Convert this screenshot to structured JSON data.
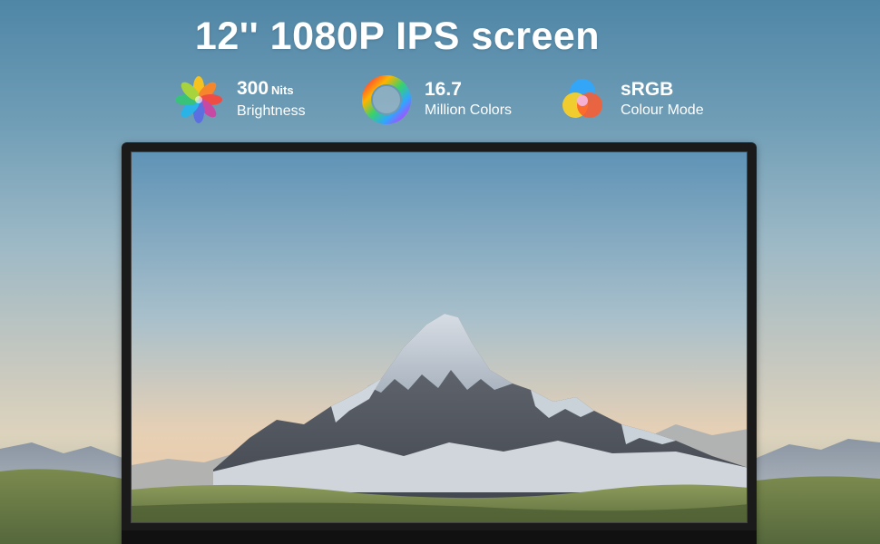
{
  "headline": "12'' 1080P IPS screen",
  "features": [
    {
      "icon": "flower-brightness-icon",
      "value": "300",
      "unit": "Nits",
      "caption": "Brightness"
    },
    {
      "icon": "color-wheel-icon",
      "value": "16.7",
      "unit": "",
      "caption": "Million Colors"
    },
    {
      "icon": "rgb-circles-icon",
      "value": "sRGB",
      "unit": "",
      "caption": "Colour Mode"
    }
  ],
  "colors": {
    "text": "#ffffff",
    "bezel": "#1a1a1a",
    "sky_top": "#4f86a6",
    "sky_bottom": "#ddd3bd",
    "grass": "#6d7f55"
  }
}
